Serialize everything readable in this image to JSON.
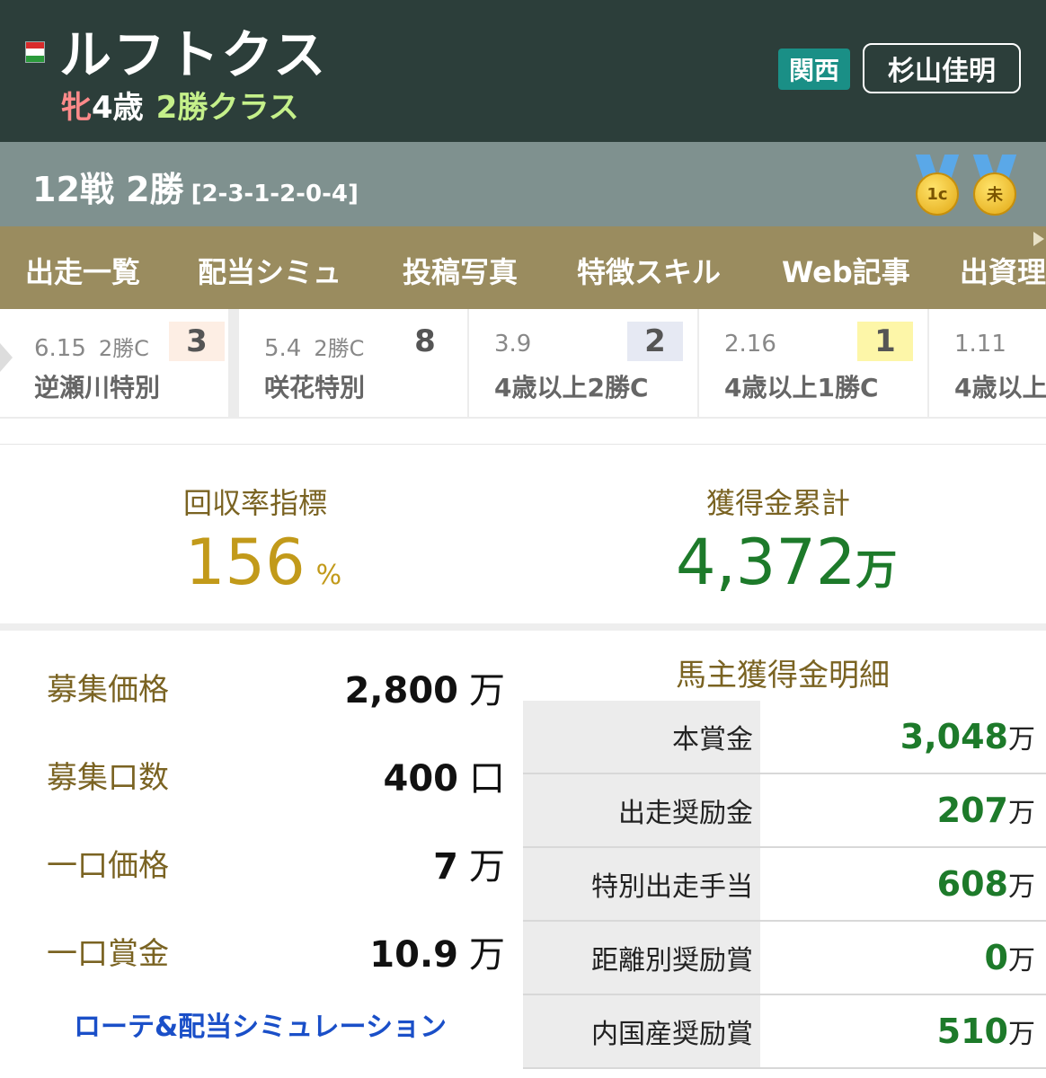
{
  "header": {
    "horse_name": "ルフトクス",
    "sex": "牝",
    "age": "4歳",
    "class": "2勝クラス",
    "region": "関西",
    "trainer": "杉山佳明",
    "flag_colors": [
      "#d92b2b",
      "#ffffff",
      "#2a9a3a"
    ]
  },
  "record": {
    "summary": "12戦 2勝",
    "detail": "[2-3-1-2-0-4]",
    "medals": [
      {
        "label": "1c",
        "icon": "medal-icon"
      },
      {
        "label": "未",
        "icon": "medal-icon"
      }
    ]
  },
  "tabs": [
    "出走一覧",
    "配当シミュ",
    "投稿写真",
    "特徴スキル",
    "Web記事",
    "出資理"
  ],
  "races": [
    {
      "date": "6.15",
      "class": "2勝C",
      "rank": "3",
      "name": "逆瀬川特別",
      "rank_bg": "#fdeee4"
    },
    {
      "date": "5.4",
      "class": "2勝C",
      "rank": "8",
      "name": "咲花特別",
      "rank_bg": "#ffffff"
    },
    {
      "date": "3.9",
      "class": "",
      "rank": "2",
      "name": "4歳以上2勝C",
      "rank_bg": "#e6e9f3"
    },
    {
      "date": "2.16",
      "class": "",
      "rank": "1",
      "name": "4歳以上1勝C",
      "rank_bg": "#fdf6a8"
    },
    {
      "date": "1.11",
      "class": "",
      "rank": "",
      "name": "4歳以上",
      "rank_bg": "#ffffff"
    }
  ],
  "stats": {
    "return_label": "回収率指標",
    "return_value": "156",
    "return_unit": "%",
    "earnings_label": "獲得金累計",
    "earnings_value": "4,372",
    "earnings_unit": "万"
  },
  "fund": [
    {
      "label": "募集価格",
      "value": "2,800",
      "unit": "万"
    },
    {
      "label": "募集口数",
      "value": "400",
      "unit": "口"
    },
    {
      "label": "一口価格",
      "value": "7",
      "unit": "万"
    },
    {
      "label": "一口賞金",
      "value": "10.9",
      "unit": "万"
    }
  ],
  "simulation_link": "ローテ&配当シミュレーション",
  "prize": {
    "title": "馬主獲得金明細",
    "rows": [
      {
        "label": "本賞金",
        "value": "3,048",
        "unit": "万"
      },
      {
        "label": "出走奨励金",
        "value": "207",
        "unit": "万"
      },
      {
        "label": "特別出走手当",
        "value": "608",
        "unit": "万"
      },
      {
        "label": "距離別奨励賞",
        "value": "0",
        "unit": "万"
      },
      {
        "label": "内国産奨励賞",
        "value": "510",
        "unit": "万"
      }
    ]
  }
}
